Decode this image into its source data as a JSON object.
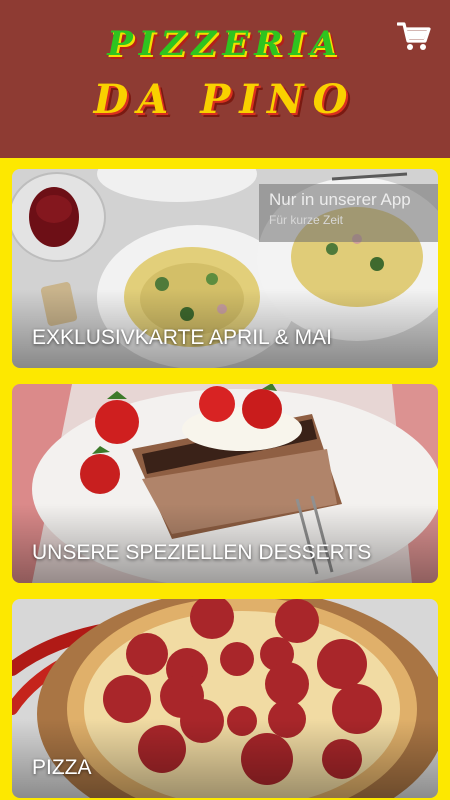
{
  "header": {
    "logo_line1": "PIZZERIA",
    "logo_line2": "DA PINO",
    "cart_icon": "shopping-cart-icon"
  },
  "colors": {
    "header_bg": "#8e3b33",
    "page_bg": "#fde800",
    "logo_green": "#2ec41f",
    "logo_yellow": "#f9d100",
    "logo_red": "#d9301e"
  },
  "cards": [
    {
      "title": "EXKLUSIVKARTE APRIL & MAI",
      "promo_title": "Nur in unserer App",
      "promo_subtitle": "Für kurze Zeit",
      "image": "pasta-dishes-photo"
    },
    {
      "title": "UNSERE SPEZIELLEN DESSERTS",
      "image": "tiramisu-strawberry-photo"
    },
    {
      "title": "PIZZA",
      "image": "pepperoni-pizza-photo"
    }
  ]
}
